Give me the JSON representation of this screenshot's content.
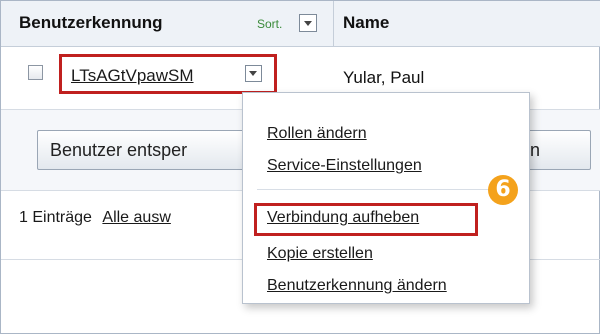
{
  "table": {
    "header": {
      "user_id_label": "Benutzerkennung",
      "sort_label": "Sort.",
      "name_label": "Name"
    },
    "rows": [
      {
        "user_id": "LTsAGtVpawSM",
        "name": "Yular, Paul",
        "checked": false
      }
    ]
  },
  "actions": {
    "lock_button": "Benutzer entsper",
    "reset_button": "etzen"
  },
  "footer": {
    "count_label": "1 Einträge",
    "select_all_label": "Alle ausw"
  },
  "context_menu": {
    "items": [
      "Rollen ändern",
      "Service-Einstellungen",
      "Verbindung aufheben",
      "Kopie erstellen",
      "Benutzerkennung ändern"
    ],
    "highlighted_item": "Verbindung aufheben"
  },
  "annotation": {
    "step_number": "6",
    "highlight_color": "#c0201f",
    "badge_color": "#f4a21c"
  },
  "icons": {
    "sort_dropdown": "chevron-down-icon",
    "row_dropdown": "chevron-down-icon"
  }
}
